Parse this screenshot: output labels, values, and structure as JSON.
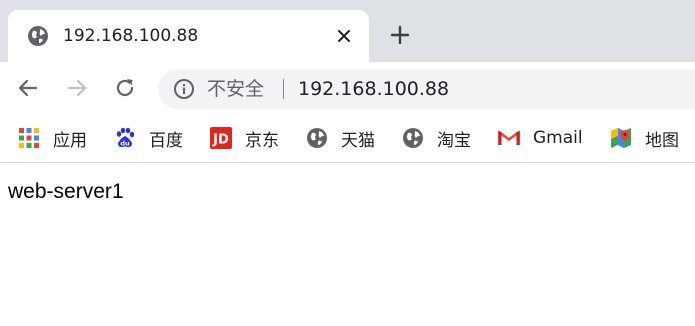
{
  "tab": {
    "title": "192.168.100.88",
    "favicon": "globe-icon"
  },
  "toolbar": {
    "back_icon": "back-arrow-icon",
    "forward_icon": "forward-arrow-icon",
    "reload_icon": "reload-icon",
    "security_label": "不安全",
    "url": "192.168.100.88"
  },
  "bookmarks": [
    {
      "label": "应用",
      "icon": "apps-grid-icon"
    },
    {
      "label": "百度",
      "icon": "baidu-paw-icon"
    },
    {
      "label": "京东",
      "icon": "jd-logo-icon"
    },
    {
      "label": "天猫",
      "icon": "globe-icon"
    },
    {
      "label": "淘宝",
      "icon": "globe-icon"
    },
    {
      "label": "Gmail",
      "icon": "gmail-icon"
    },
    {
      "label": "地图",
      "icon": "maps-pin-icon"
    }
  ],
  "page": {
    "text": "web-server1"
  },
  "colors": {
    "tabstrip_bg": "#dee1e6",
    "omnibox_bg": "#f1f3f4",
    "icon_gray": "#5f6368",
    "disabled_gray": "#bdc1c6",
    "jd_red": "#e1251b",
    "baidu_blue": "#2932e1",
    "gmail_red": "#ea4335"
  }
}
